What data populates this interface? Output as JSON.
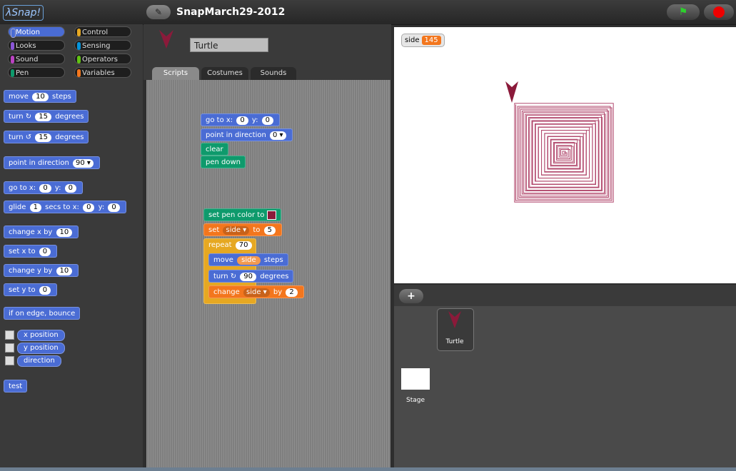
{
  "app": {
    "logo_text": "λSnap!",
    "project_title": "SnapMarch29-2012"
  },
  "toolbar": {
    "edit_icon": "pencil-icon",
    "flag_icon": "green-flag-icon",
    "stop_icon": "stop-sign-icon"
  },
  "categories": [
    {
      "label": "Motion",
      "color": "#4a6cd4"
    },
    {
      "label": "Control",
      "color": "#e6a822"
    },
    {
      "label": "Looks",
      "color": "#8a55d7"
    },
    {
      "label": "Sensing",
      "color": "#0494dc"
    },
    {
      "label": "Sound",
      "color": "#bb42c3"
    },
    {
      "label": "Operators",
      "color": "#62c213"
    },
    {
      "label": "Pen",
      "color": "#0e9a6c"
    },
    {
      "label": "Variables",
      "color": "#f3761d"
    }
  ],
  "palette": {
    "move": {
      "label1": "move",
      "value": "10",
      "label2": "steps"
    },
    "turn_cw": {
      "label1": "turn ↻",
      "value": "15",
      "label2": "degrees"
    },
    "turn_ccw": {
      "label1": "turn ↺",
      "value": "15",
      "label2": "degrees"
    },
    "point_dir": {
      "label1": "point in direction",
      "value": "90"
    },
    "goto": {
      "label1": "go to x:",
      "x": "0",
      "label2": "y:",
      "y": "0"
    },
    "glide": {
      "label1": "glide",
      "secs": "1",
      "label2": "secs to x:",
      "x": "0",
      "label3": "y:",
      "y": "0"
    },
    "change_x": {
      "label1": "change x by",
      "value": "10"
    },
    "set_x": {
      "label1": "set x to",
      "value": "0"
    },
    "change_y": {
      "label1": "change y by",
      "value": "10"
    },
    "set_y": {
      "label1": "set y to",
      "value": "0"
    },
    "bounce": {
      "label": "if on edge, bounce"
    },
    "x_position": "x position",
    "y_position": "y position",
    "direction": "direction",
    "test": "test"
  },
  "sprite": {
    "name": "Turtle"
  },
  "tabs": [
    "Scripts",
    "Costumes",
    "Sounds"
  ],
  "script1": {
    "goto": {
      "label1": "go to x:",
      "x": "0",
      "label2": "y:",
      "y": "0"
    },
    "point_dir": {
      "label1": "point in direction",
      "value": "0"
    },
    "clear": "clear",
    "pen_down": "pen down"
  },
  "script2": {
    "set_pen_color": {
      "label": "set pen color to",
      "color": "#8b1a3a"
    },
    "set_var": {
      "label1": "set",
      "var": "side",
      "label2": "to",
      "value": "5"
    },
    "repeat": {
      "label": "repeat",
      "value": "70"
    },
    "move": {
      "label1": "move",
      "var": "side",
      "label2": "steps"
    },
    "turn": {
      "label1": "turn ↻",
      "value": "90",
      "label2": "degrees"
    },
    "change": {
      "label1": "change",
      "var": "side",
      "label2": "by",
      "value": "2"
    }
  },
  "stage": {
    "watcher": {
      "name": "side",
      "value": "145"
    },
    "pen_color": "#b24a6e",
    "turtle_color": "#8b1a3a"
  },
  "corral": {
    "add_icon": "+",
    "sprite_label": "Turtle",
    "stage_label": "Stage"
  }
}
